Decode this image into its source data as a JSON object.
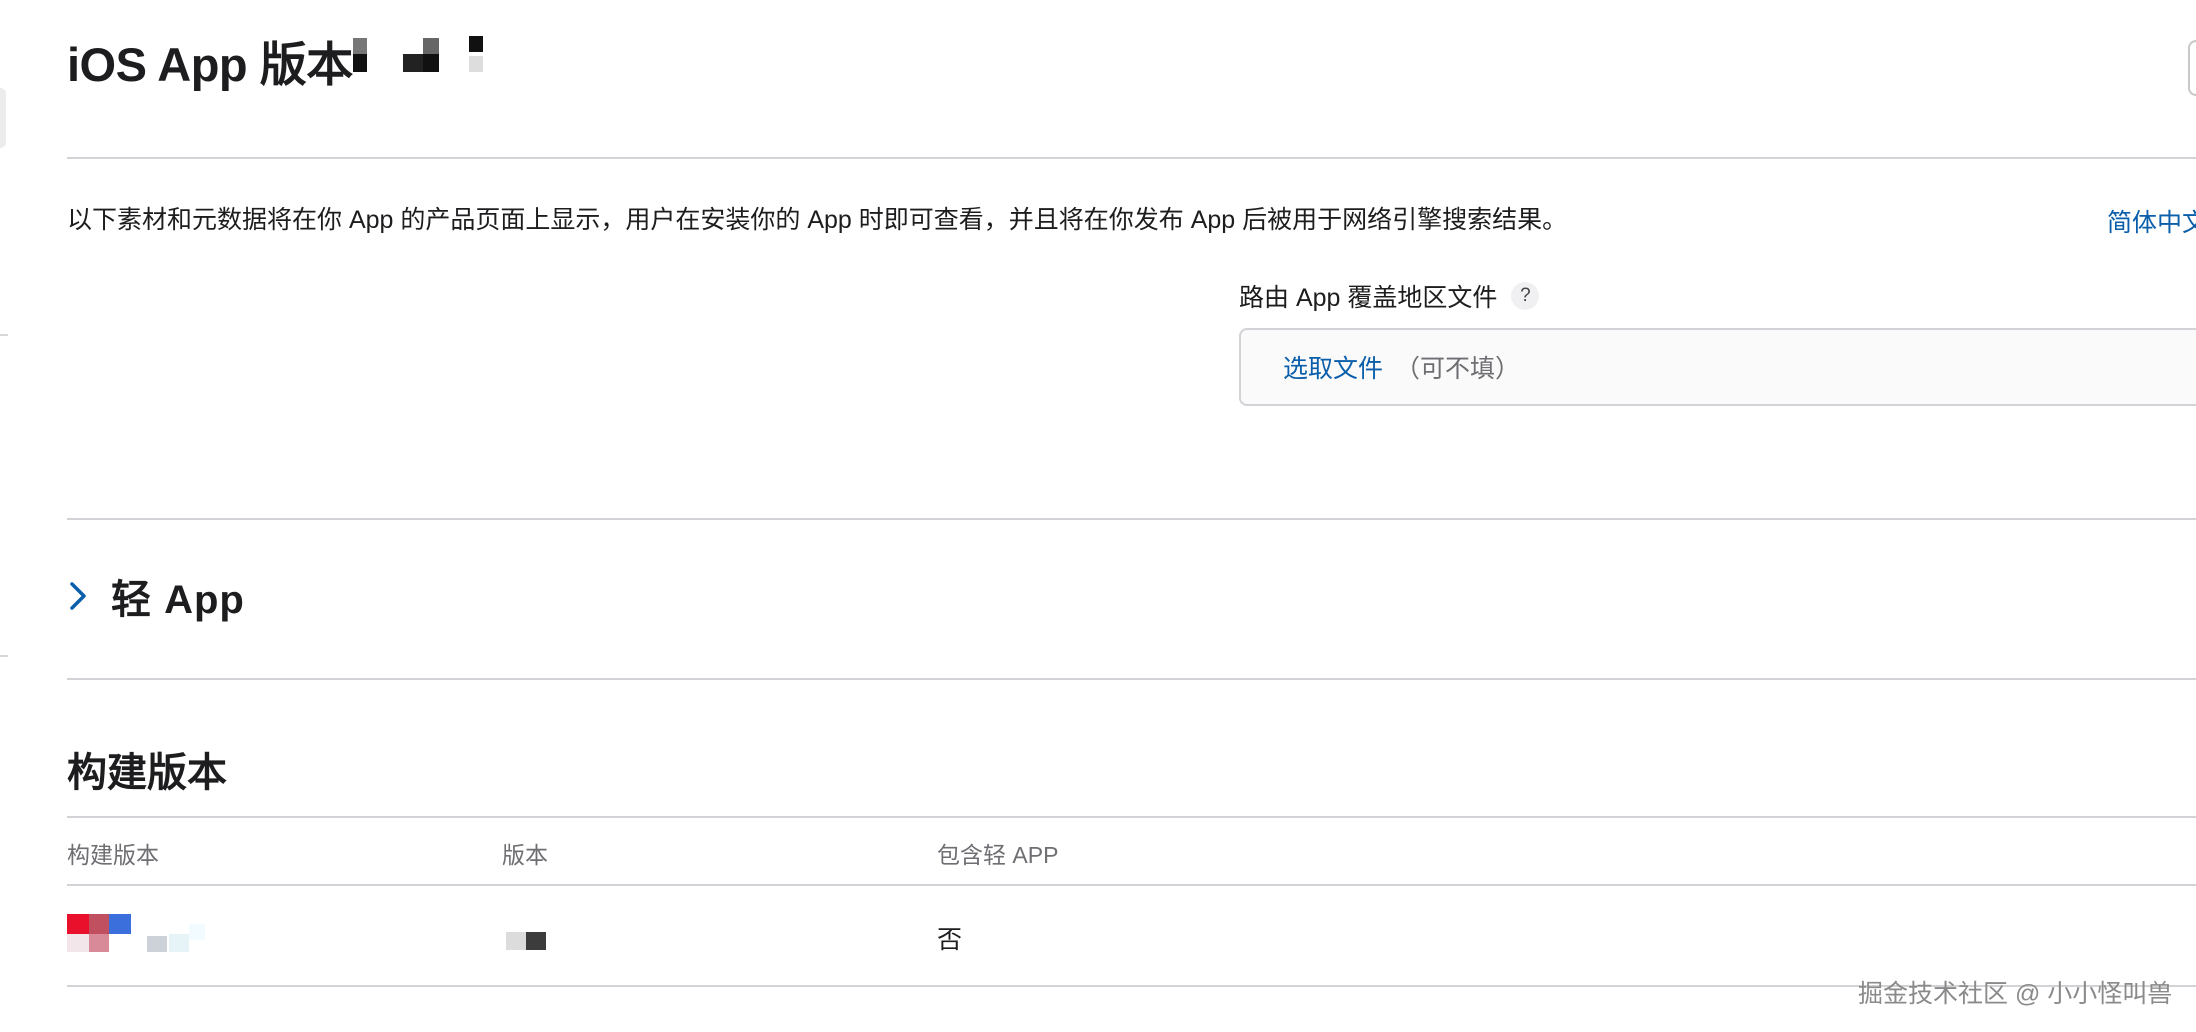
{
  "header": {
    "title": "iOS App 版本"
  },
  "intro": {
    "text": "以下素材和元数据将在你 App 的产品页面上显示，用户在安装你的 App 时即可查看，并且将在你发布 App 后被用于网络引擎搜索结果。",
    "language_link": "简体中文"
  },
  "routing": {
    "label": "路由 App 覆盖地区文件",
    "help": "?",
    "choose_file": "选取文件",
    "optional": "（可不填）"
  },
  "app_clip": {
    "title": "轻 App"
  },
  "builds": {
    "section_title": "构建版本",
    "columns": [
      "构建版本",
      "版本",
      "包含轻 APP"
    ],
    "rows": [
      {
        "includes_clip": "否"
      }
    ]
  },
  "watermark": "掘金技术社区 @ 小小怪叫兽",
  "colors": {
    "accent": "#0a5eaa",
    "divider": "#d2d2d7",
    "muted": "#6e6e73"
  }
}
